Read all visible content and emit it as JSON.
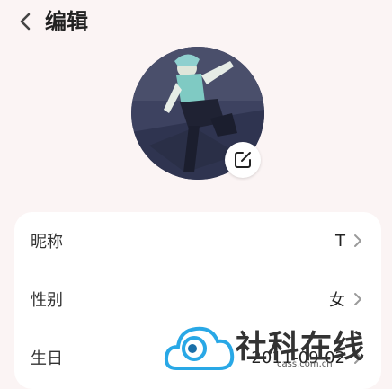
{
  "header": {
    "back_icon": "chevron-left-icon",
    "title": "编辑"
  },
  "avatar": {
    "edit_icon": "edit-square-icon"
  },
  "profile_rows": [
    {
      "label": "昵称",
      "value": "T"
    },
    {
      "label": "性别",
      "value": "女"
    },
    {
      "label": "生日",
      "value": "2011-09-02"
    }
  ],
  "watermark": {
    "text": "社科在线",
    "url": "cass.com.cn"
  },
  "colors": {
    "background": "#fbf4f4",
    "card": "#ffffff",
    "text": "#222222",
    "chevron": "#9a9a9a",
    "watermark_blue": "#29a8e6"
  }
}
